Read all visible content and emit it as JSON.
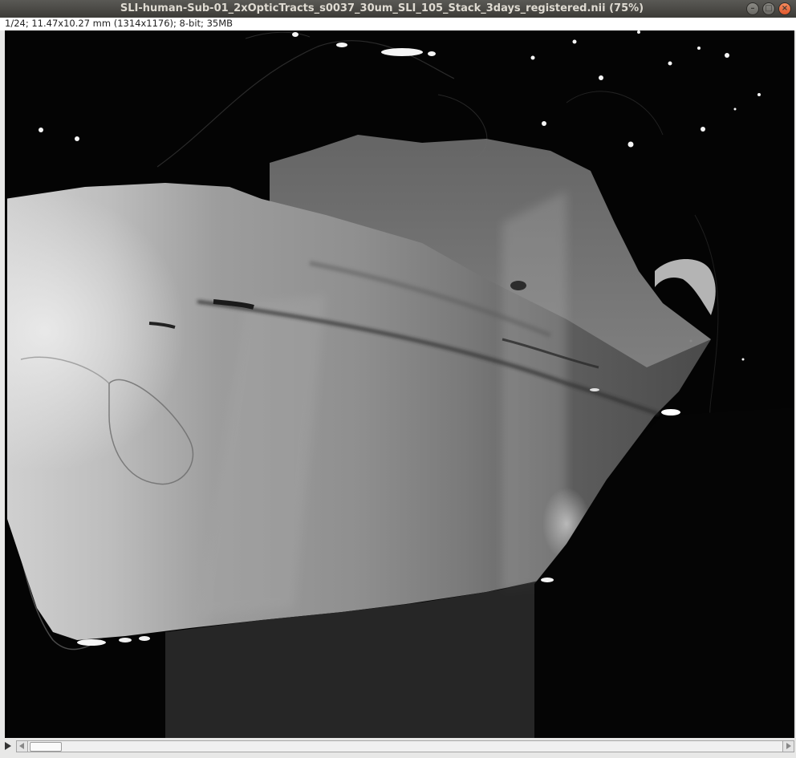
{
  "window": {
    "title": "SLI-human-Sub-01_2xOpticTracts_s0037_30um_SLI_105_Stack_3days_registered.nii (75%)",
    "controls": {
      "minimize_icon": "minimize-icon",
      "maximize_icon": "maximize-icon",
      "close_icon": "close-icon"
    }
  },
  "info_bar": {
    "text": "1/24; 11.47x10.27 mm (1314x1176); 8-bit; 35MB"
  },
  "image": {
    "description_icon": "microscopy-image",
    "background_color": "#040404"
  },
  "stack_slider": {
    "play_icon": "play-icon",
    "left_arrow_icon": "arrow-left-icon",
    "right_arrow_icon": "arrow-right-icon",
    "current_slice": 1,
    "total_slices": 24
  }
}
